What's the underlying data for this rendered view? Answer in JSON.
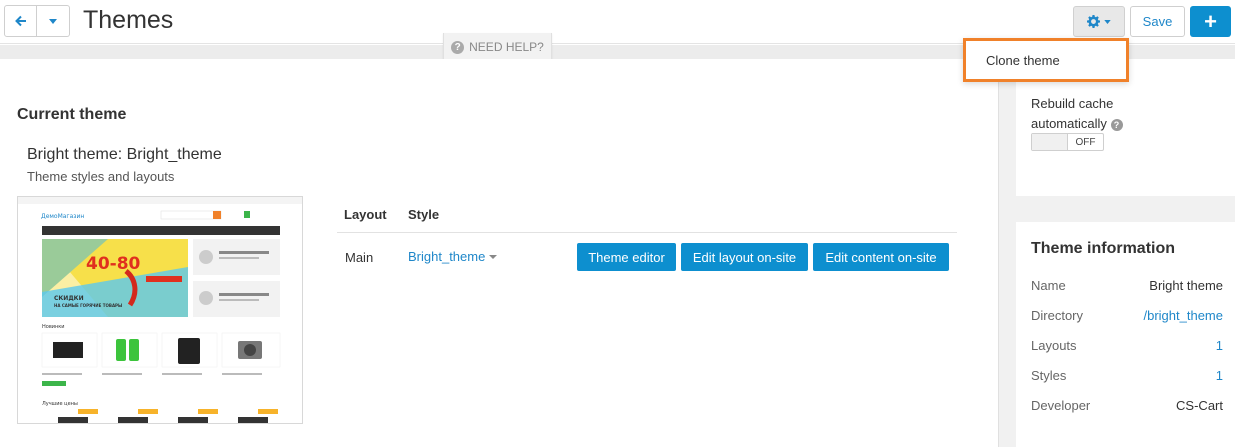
{
  "header": {
    "title": "Themes",
    "save_label": "Save",
    "plus_label": "+"
  },
  "help": {
    "label": "NEED HELP?"
  },
  "dropdown": {
    "items": [
      {
        "label": "Clone theme"
      }
    ]
  },
  "current_theme": {
    "section_title": "Current theme",
    "name": "Bright theme: Bright_theme",
    "subtitle": "Theme styles and layouts",
    "table": {
      "headers": [
        "Layout",
        "Style"
      ],
      "row": {
        "layout": "Main",
        "style": "Bright_theme",
        "buttons": [
          "Theme editor",
          "Edit layout on-site",
          "Edit content on-site"
        ]
      }
    }
  },
  "preview": {
    "logo": "ДемоМагазин",
    "banner_number": "40-80",
    "banner_text_1": "СКИДКИ",
    "banner_text_2": "НА САМЫЕ ГОРЯЧИЕ ТОВАРЫ",
    "section_new": "Новинки",
    "section_best": "Лучшие цены"
  },
  "sidebar": {
    "rebuild_label": "Rebuild cache automatically",
    "toggle_state": "OFF",
    "info_title": "Theme information",
    "info": [
      {
        "key": "Name",
        "value": "Bright theme"
      },
      {
        "key": "Directory",
        "value": "/bright_theme"
      },
      {
        "key": "Layouts",
        "value": "1"
      },
      {
        "key": "Styles",
        "value": "1"
      },
      {
        "key": "Developer",
        "value": "CS-Cart"
      }
    ]
  },
  "colors": {
    "accent": "#0d8fcf",
    "link": "#1f87c9",
    "highlight": "#f0812a"
  }
}
